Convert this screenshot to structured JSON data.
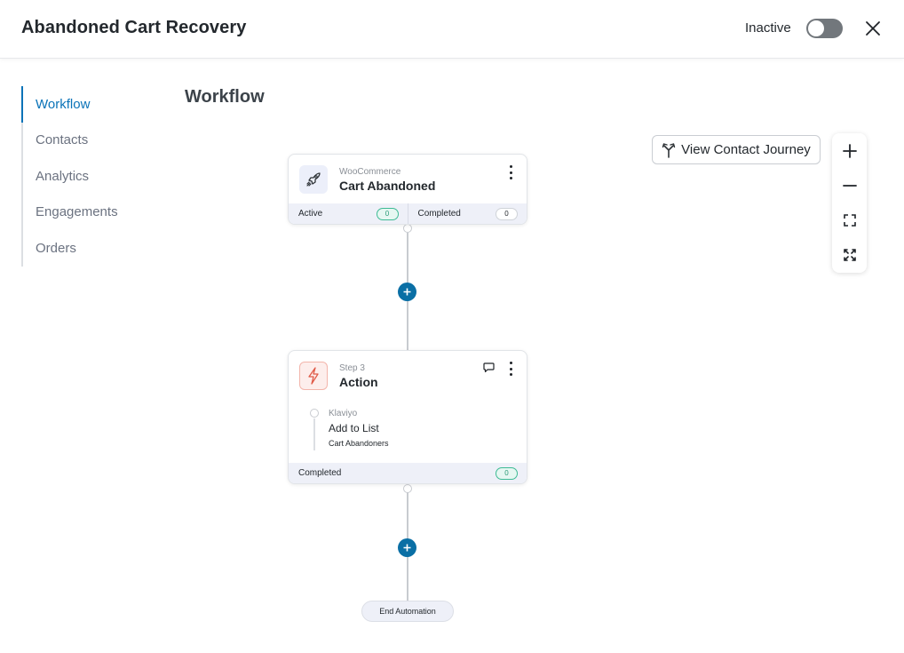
{
  "header": {
    "title": "Abandoned Cart Recovery",
    "status_label": "Inactive",
    "toggle_on": false
  },
  "sidebar": {
    "items": [
      {
        "label": "Workflow",
        "active": true
      },
      {
        "label": "Contacts",
        "active": false
      },
      {
        "label": "Analytics",
        "active": false
      },
      {
        "label": "Engagements",
        "active": false
      },
      {
        "label": "Orders",
        "active": false
      }
    ]
  },
  "main": {
    "title": "Workflow",
    "journey_button": "View Contact Journey",
    "zoom": {
      "zoom_in": "plus-icon",
      "zoom_out": "minus-icon",
      "fit": "fit-view-icon",
      "fullscreen": "fullscreen-icon"
    }
  },
  "trigger": {
    "vendor": "WooCommerce",
    "title": "Cart Abandoned",
    "icon": "rocket-icon",
    "active_label": "Active",
    "active_count": "0",
    "completed_label": "Completed",
    "completed_count": "0"
  },
  "action": {
    "step": "Step 3",
    "title": "Action",
    "icon": "lightning-icon",
    "sub_vendor": "Klaviyo",
    "sub_title": "Add to List",
    "sub_detail": "Cart Abandoners",
    "completed_label": "Completed",
    "completed_count": "0"
  },
  "end": {
    "label": "End Automation"
  },
  "colors": {
    "accent": "#0a73b8",
    "add_button": "#0a6fa5",
    "toggle_off": "#72777c",
    "success": "#3dbb94",
    "danger": "#e05a47"
  }
}
